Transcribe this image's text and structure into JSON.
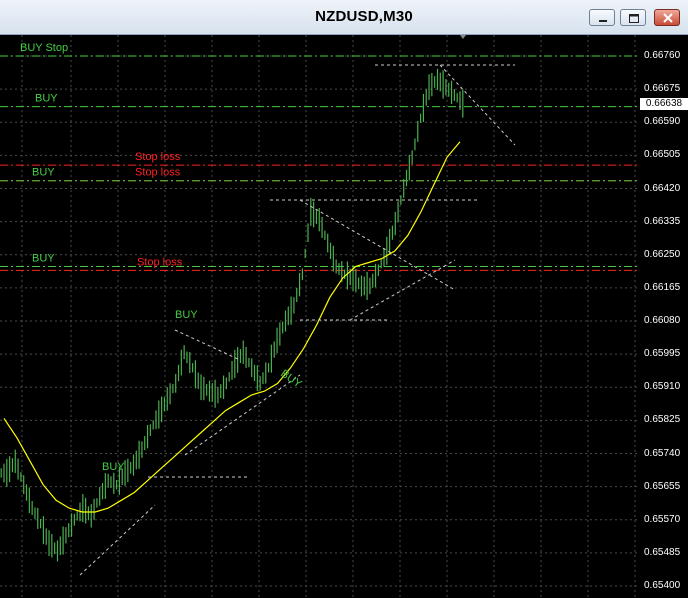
{
  "window": {
    "title": "NZDUSD,M30"
  },
  "buttons": {
    "minimize": "minimize",
    "maximize": "maximize",
    "close": "close"
  },
  "chart_data": {
    "type": "line",
    "symbol": "NZDUSD",
    "timeframe": "M30",
    "current_price": "0.66638",
    "y_ticks": [
      "0.66760",
      "0.66675",
      "0.66590",
      "0.66505",
      "0.66420",
      "0.66335",
      "0.66250",
      "0.66165",
      "0.66080",
      "0.65995",
      "0.65910",
      "0.65825",
      "0.65740",
      "0.65655",
      "0.65570",
      "0.65485",
      "0.65400"
    ],
    "ylim": [
      0.654,
      0.6676
    ],
    "grid": true,
    "price_series_color": "#4caf50",
    "ma_color": "#ffff00",
    "close_approx": [
      0.6569,
      0.6572,
      0.6566,
      0.656,
      0.6556,
      0.6551,
      0.6549,
      0.6553,
      0.6557,
      0.656,
      0.6558,
      0.6563,
      0.6567,
      0.6566,
      0.6569,
      0.6571,
      0.6575,
      0.658,
      0.6584,
      0.6588,
      0.6592,
      0.66,
      0.6596,
      0.6591,
      0.659,
      0.6589,
      0.6592,
      0.6597,
      0.66,
      0.6596,
      0.6592,
      0.6596,
      0.6603,
      0.6608,
      0.6612,
      0.662,
      0.6636,
      0.6634,
      0.6628,
      0.6622,
      0.662,
      0.6619,
      0.6617,
      0.6617,
      0.6621,
      0.6626,
      0.6633,
      0.6642,
      0.665,
      0.666,
      0.6668,
      0.667,
      0.6668,
      0.6666,
      0.66638
    ],
    "ma_approx": [
      0.6583,
      0.6578,
      0.6572,
      0.6566,
      0.6562,
      0.656,
      0.6559,
      0.6559,
      0.656,
      0.6562,
      0.6564,
      0.6567,
      0.657,
      0.6573,
      0.6576,
      0.6579,
      0.6582,
      0.6585,
      0.6587,
      0.6589,
      0.659,
      0.6592,
      0.6596,
      0.6601,
      0.6607,
      0.6614,
      0.6619,
      0.6622,
      0.6623,
      0.6624,
      0.6626,
      0.663,
      0.6636,
      0.6643,
      0.665,
      0.6654
    ],
    "levels": [
      {
        "label": "BUY Stop",
        "price": 0.6676,
        "color": "#44cc44",
        "style": "dashdot"
      },
      {
        "label": "BUY",
        "price": 0.6663,
        "color": "#44cc44",
        "style": "dashdot"
      },
      {
        "label": "Stop loss",
        "price": 0.6648,
        "color": "#ff2222",
        "style": "dashdot"
      },
      {
        "label": "Stop loss",
        "price": 0.6644,
        "color": "#ff2222",
        "style": "dashdot"
      },
      {
        "label": "BUY",
        "price": 0.6644,
        "color": "#44cc44",
        "style": "dashdot"
      },
      {
        "label": "BUY",
        "price": 0.6622,
        "color": "#44cc44",
        "style": "dashdot"
      },
      {
        "label": "Stop loss",
        "price": 0.6621,
        "color": "#ff2222",
        "style": "dashdot"
      }
    ],
    "annotations": [
      {
        "text": "BUY",
        "color": "#44cc44"
      },
      {
        "text": "BUY",
        "color": "#44cc44"
      },
      {
        "text": "BUY",
        "color": "#44cc44"
      }
    ]
  }
}
